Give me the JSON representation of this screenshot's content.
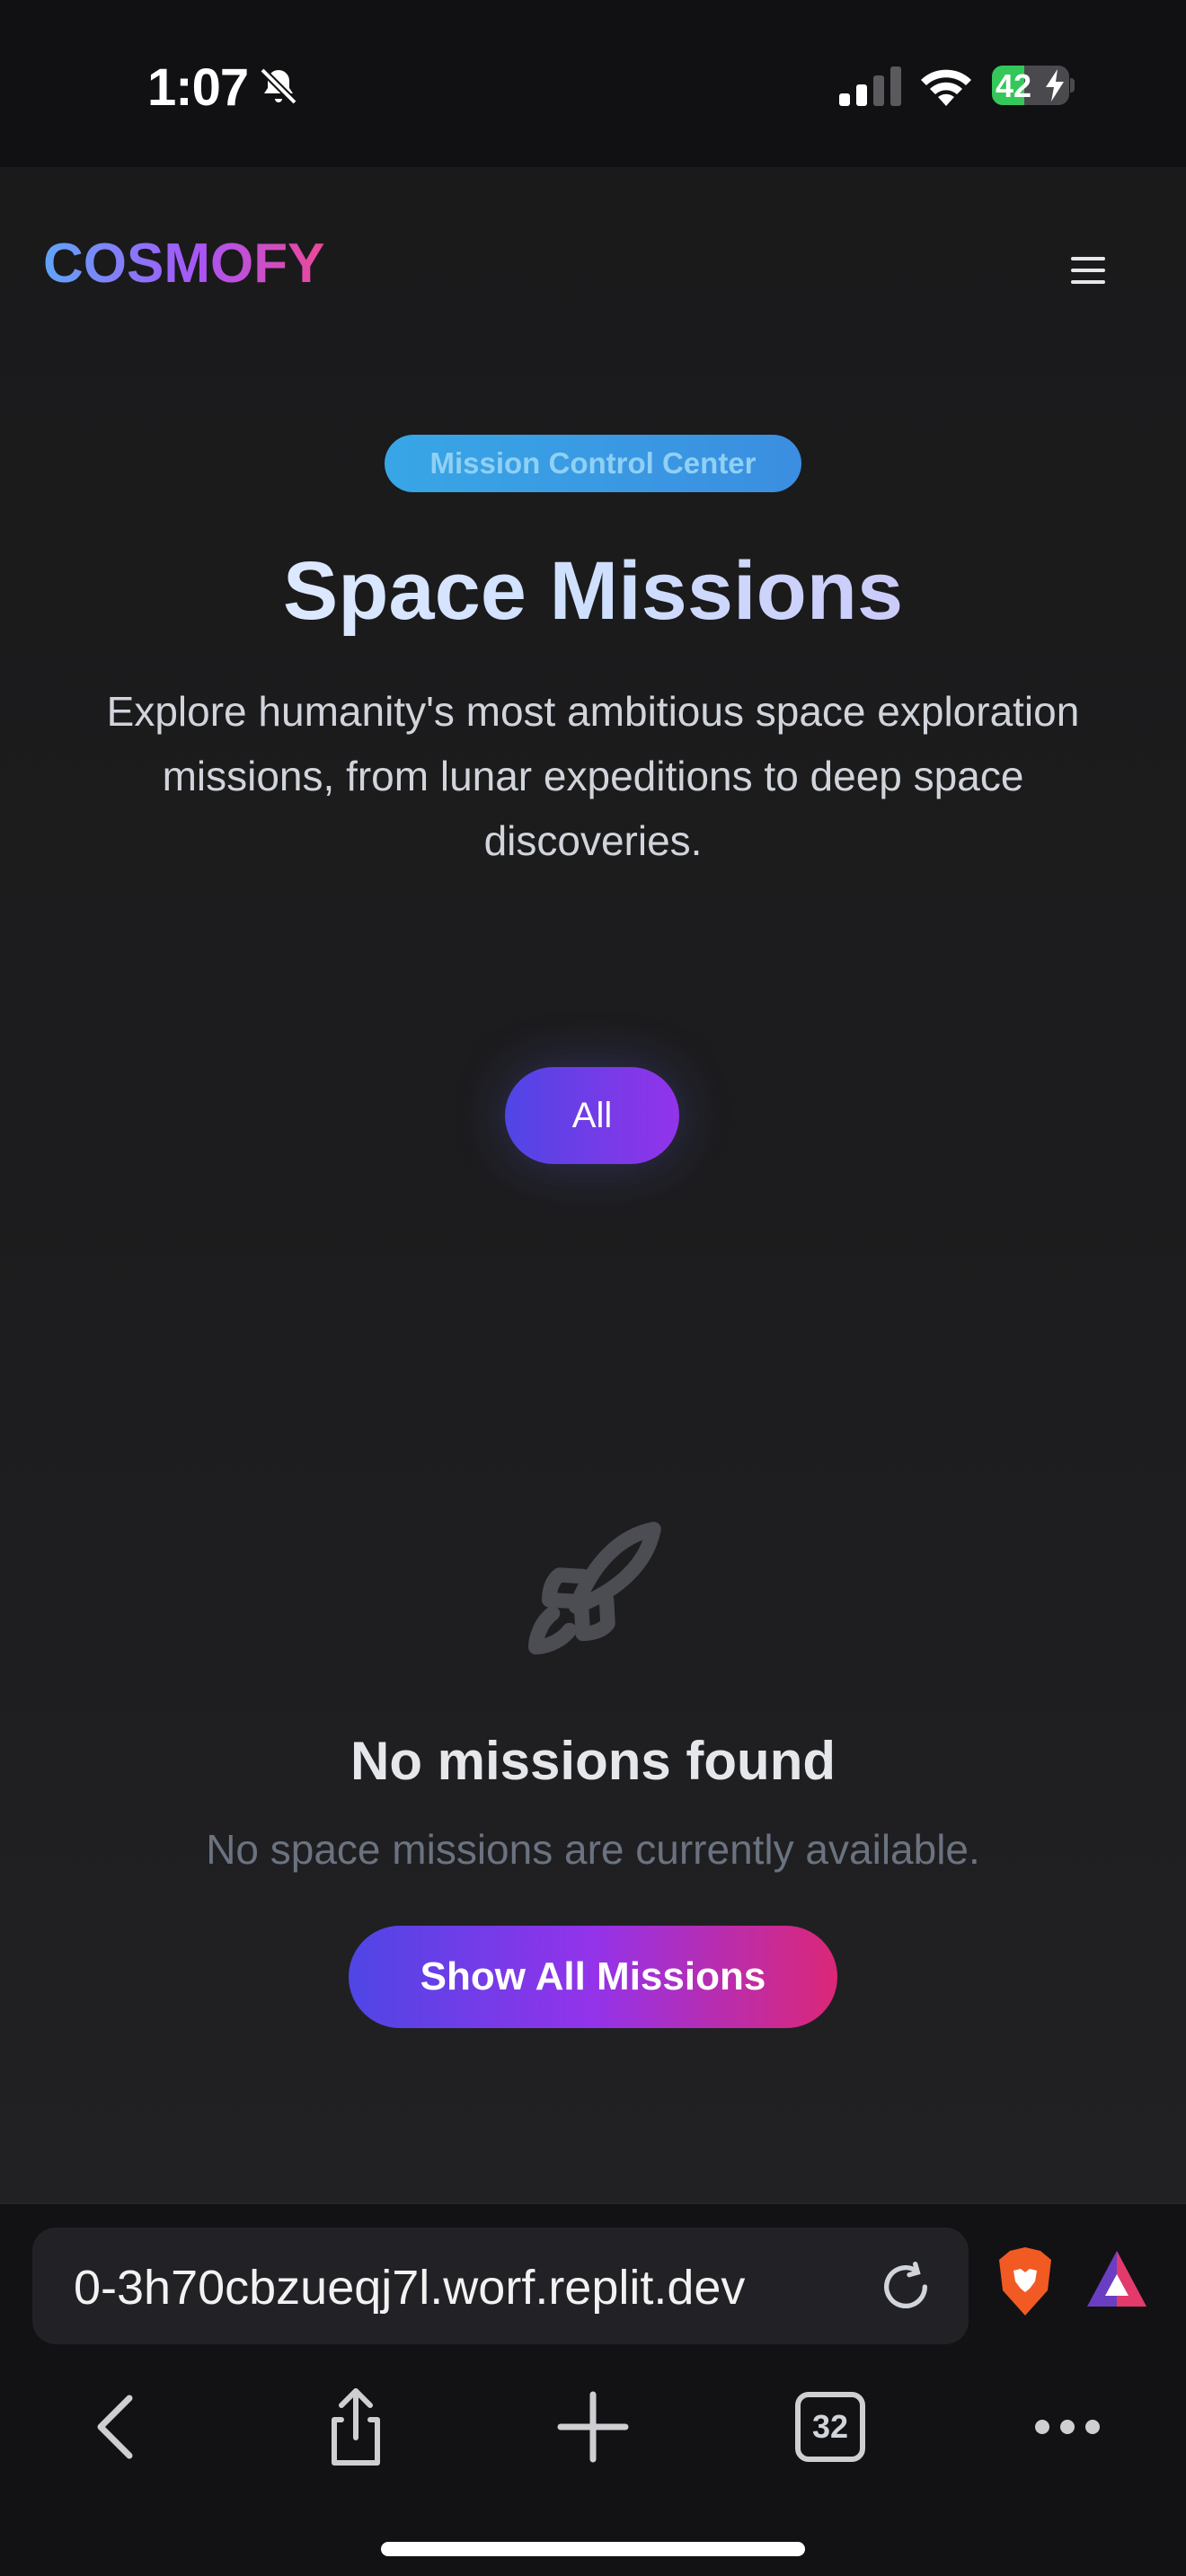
{
  "status": {
    "time": "1:07",
    "battery_percent": 42,
    "battery_label": "42",
    "charging": true
  },
  "header": {
    "logo": "COSMOFY",
    "menu_icon": "hamburger-menu-icon"
  },
  "hero": {
    "badge": "Mission Control Center",
    "title": "Space Missions",
    "subtitle": "Explore humanity's most ambitious space exploration missions, from lunar expeditions to deep space discoveries."
  },
  "filters": {
    "active": "All",
    "items": [
      "All"
    ]
  },
  "empty_state": {
    "icon": "rocket-icon",
    "title": "No missions found",
    "message": "No space missions are currently available.",
    "button": "Show All Missions"
  },
  "browser": {
    "url": "0-3h70cbzueqj7l.worf.replit.dev",
    "tabs_count": "32"
  },
  "colors": {
    "accent_start": "#4f46e5",
    "accent_mid": "#9333ea",
    "accent_end": "#db2777",
    "badge": "#38a6e6",
    "background": "#1a1a1b"
  }
}
